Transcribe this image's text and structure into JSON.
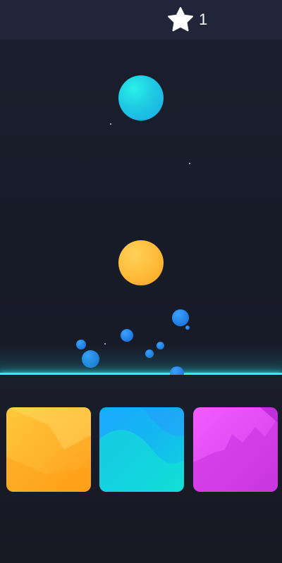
{
  "hud": {
    "score_icon": "star-icon",
    "score": "1"
  },
  "falling_balls": [
    {
      "name": "ball-cyan",
      "color": "#1fc9e3"
    },
    {
      "name": "ball-orange",
      "color": "#ffbb38"
    }
  ],
  "colors": {
    "background": "#181b28",
    "hit_line": "#28f0ee",
    "bubble": "#1f79e0"
  },
  "pads": [
    {
      "name": "pad-orange",
      "color": "#ffb22b"
    },
    {
      "name": "pad-cyan",
      "color": "#14b8f0"
    },
    {
      "name": "pad-magenta",
      "color": "#e04cf2"
    }
  ]
}
